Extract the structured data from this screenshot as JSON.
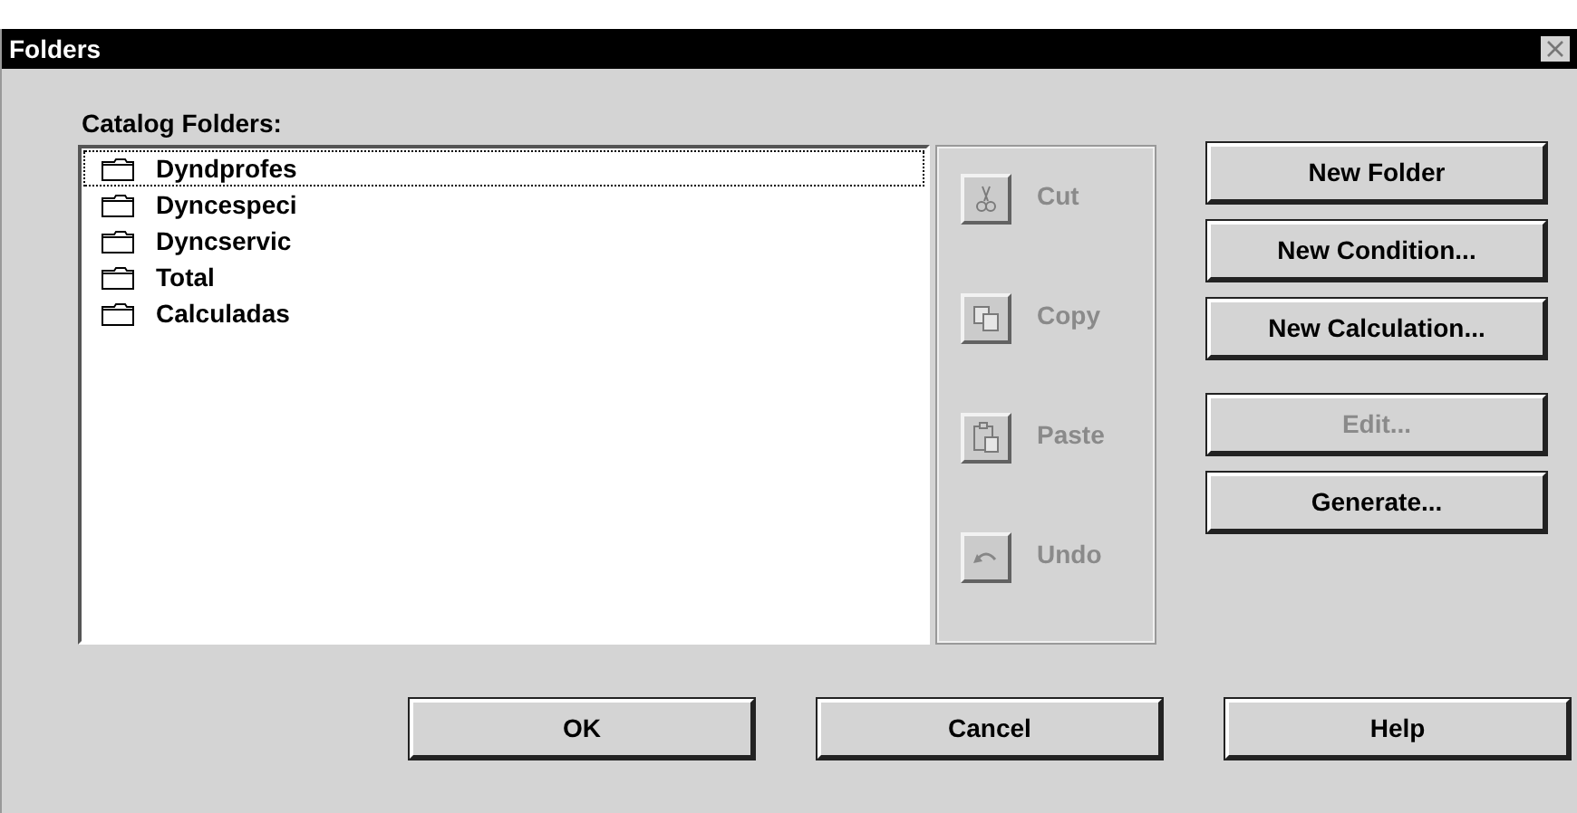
{
  "window": {
    "title": "Folders"
  },
  "list_label": {
    "text": "Catalog Folders:"
  },
  "folders": [
    {
      "name": "Dyndprofes",
      "selected": true
    },
    {
      "name": "Dyncespeci",
      "selected": false
    },
    {
      "name": "Dyncservic",
      "selected": false
    },
    {
      "name": "Total",
      "selected": false
    },
    {
      "name": "Calculadas",
      "selected": false
    }
  ],
  "tools": [
    {
      "kind": "cut",
      "label": "Cut",
      "disabled": true
    },
    {
      "kind": "copy",
      "label": "Copy",
      "disabled": true
    },
    {
      "kind": "paste",
      "label": "Paste",
      "disabled": true
    },
    {
      "kind": "undo",
      "label": "Undo",
      "disabled": true
    }
  ],
  "actions": [
    {
      "label": "New Folder",
      "disabled": false
    },
    {
      "label": "New Condition...",
      "disabled": false
    },
    {
      "label": "New Calculation...",
      "disabled": false
    },
    {
      "label": "Edit...",
      "disabled": true
    },
    {
      "label": "Generate...",
      "disabled": false
    }
  ],
  "buttons": [
    {
      "label": "OK"
    },
    {
      "label": "Cancel"
    },
    {
      "label": "Help"
    }
  ]
}
